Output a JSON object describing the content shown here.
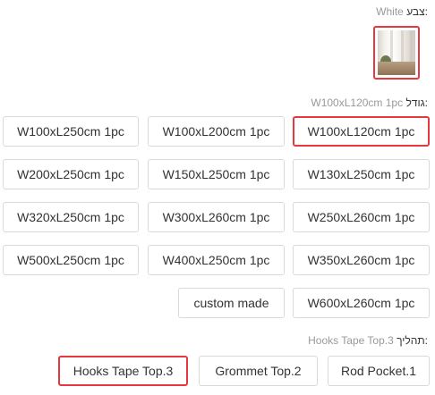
{
  "color": {
    "label": "צבע:",
    "value": "White",
    "swatch": "curtain-photo-white",
    "selected_border": "#e5393f"
  },
  "size": {
    "label": "גודל:",
    "value": "W100xL120cm 1pc",
    "options": [
      "W100xL250cm 1pc",
      "W100xL200cm 1pc",
      "W100xL120cm 1pc",
      "W200xL250cm 1pc",
      "W150xL250cm 1pc",
      "W130xL250cm 1pc",
      "W320xL250cm 1pc",
      "W300xL260cm 1pc",
      "W250xL260cm 1pc",
      "W500xL250cm 1pc",
      "W400xL250cm 1pc",
      "W350xL260cm 1pc",
      "custom made",
      "W600xL260cm 1pc"
    ],
    "selected": "W100xL120cm 1pc"
  },
  "process": {
    "label": "תהליך:",
    "value": "Hooks Tape Top.3",
    "options": [
      "Hooks Tape Top.3",
      "Grommet Top.2",
      "Rod Pocket.1"
    ],
    "selected": "Hooks Tape Top.3"
  }
}
